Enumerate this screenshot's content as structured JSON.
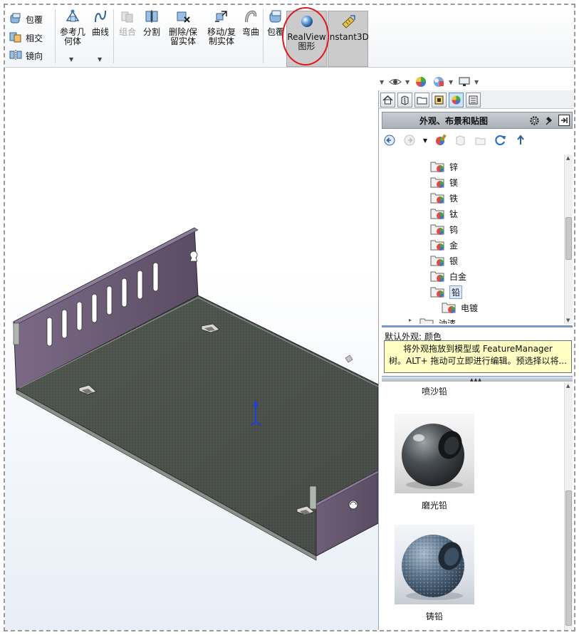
{
  "toolbar": {
    "small_buttons": [
      {
        "name": "wrap-small",
        "label": "包覆"
      },
      {
        "name": "intersect",
        "label": "相交"
      },
      {
        "name": "mirror",
        "label": "镜向"
      }
    ],
    "ref_geometry": {
      "line1": "参考几",
      "line2": "何体"
    },
    "curves": {
      "label": "曲线"
    },
    "combine": {
      "label": "组合"
    },
    "split": {
      "label": "分割"
    },
    "delete_keep": {
      "line1": "删除/保",
      "line2": "留实体"
    },
    "move_copy": {
      "line1": "移动/复",
      "line2": "制实体"
    },
    "flex": {
      "label": "弯曲"
    },
    "wrap": {
      "label": "包覆"
    },
    "realview": {
      "line1": "RealView",
      "line2": "图形"
    },
    "instant3d": {
      "label": "Instant3D"
    }
  },
  "task_pane": {
    "header_title": "外观、布景和贴图",
    "tree_items": [
      "锌",
      "镁",
      "铁",
      "钛",
      "钨",
      "金",
      "银",
      "白金",
      "铅",
      "电镀",
      "油漆"
    ],
    "selected_item": "铅",
    "default_appearance": "默认外观: 颜色",
    "tooltip_line1": "将外观拖放到模型或 FeatureManager",
    "tooltip_line2": "树。ALT+ 拖动可立即进行编辑。预选择以将...",
    "swatches": [
      "喷沙铅",
      "磨光铅",
      "铸铅"
    ]
  },
  "colors": {
    "sheet_metal_inner": "#4f5450",
    "sheet_metal_wall": "#5e5166",
    "highlight_circle": "#e0161c",
    "tooltip_bg": "#ffffc4"
  }
}
